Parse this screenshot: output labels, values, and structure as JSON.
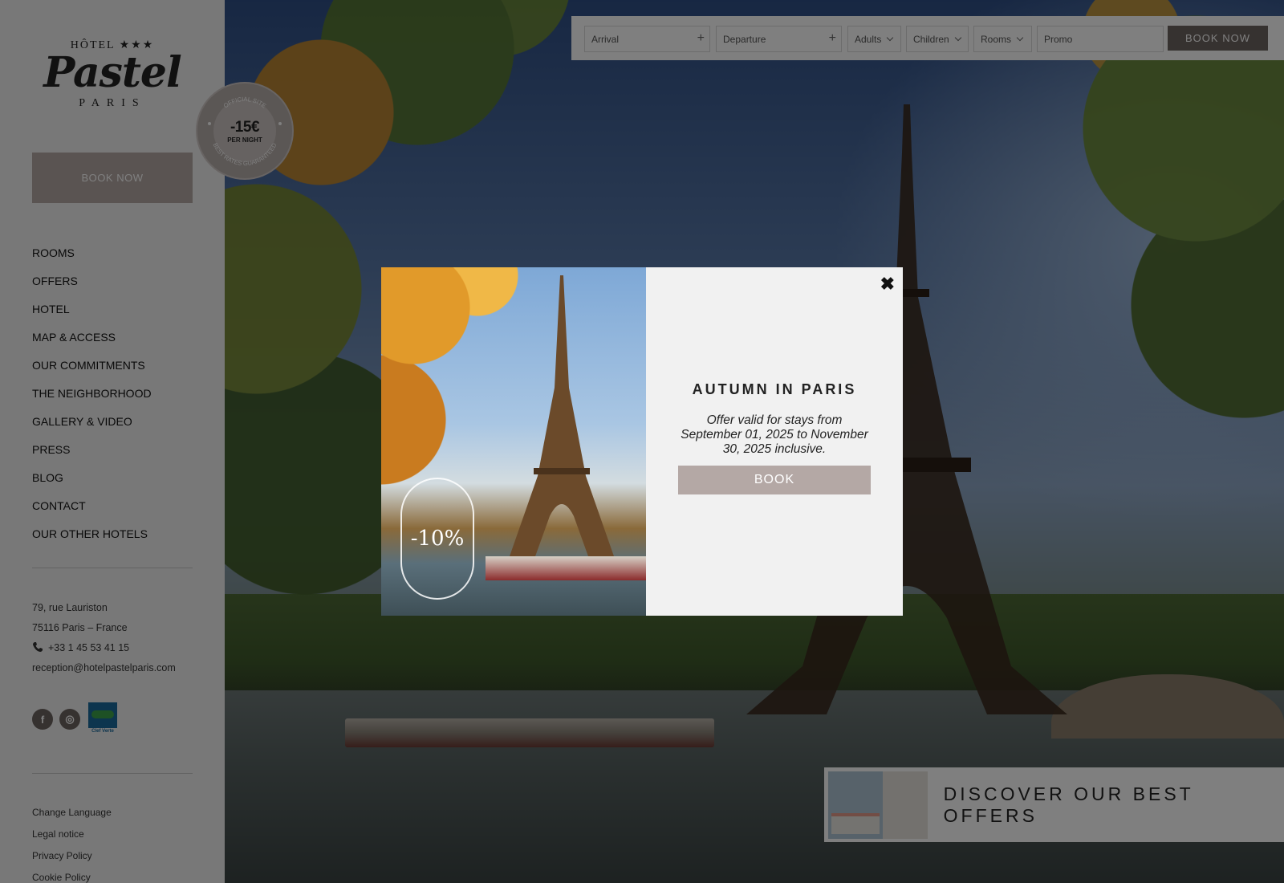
{
  "sidebar": {
    "logo": {
      "top": "HÔTEL ★★★",
      "name": "Pastel",
      "city": "PARIS"
    },
    "book_label": "BOOK NOW",
    "nav": [
      "ROOMS",
      "OFFERS",
      "HOTEL",
      "MAP & ACCESS",
      "OUR COMMITMENTS",
      "THE NEIGHBORHOOD",
      "GALLERY & VIDEO",
      "PRESS",
      "BLOG",
      "CONTACT",
      "OUR OTHER HOTELS"
    ],
    "address": {
      "street": "79, rue Lauriston",
      "city": "75116 Paris – France",
      "phone": "+33 1 45 53 41 15",
      "email": "reception@hotelpastelparis.com"
    },
    "socials": {
      "facebook": "f",
      "instagram": "◎",
      "clef_verte_label": "Clef Verte"
    },
    "footer_links": [
      "Change Language",
      "Legal notice",
      "Privacy Policy",
      "Cookie Policy"
    ]
  },
  "badge": {
    "top_text": "OFFICIAL SITE",
    "amount": "-15€",
    "per": "PER NIGHT",
    "bottom_text": "BEST RATES GUARANTEED"
  },
  "booking_bar": {
    "arrival": "Arrival",
    "departure": "Departure",
    "adults": "Adults",
    "children": "Children",
    "rooms": "Rooms",
    "promo_placeholder": "Promo",
    "book_label": "BOOK NOW"
  },
  "offers_bar": {
    "label": "DISCOVER OUR BEST OFFERS"
  },
  "modal": {
    "title": "AUTUMN IN PARIS",
    "description": "Offer valid for stays from September 01, 2025 to November 30, 2025 inclusive.",
    "book_label": "BOOK",
    "close_glyph": "✖",
    "stamp_text": "-10%"
  },
  "colors": {
    "accent": "#b4a8a5",
    "dark_button": "#6d6460",
    "sidebar_bg": "#f1f1f1"
  }
}
